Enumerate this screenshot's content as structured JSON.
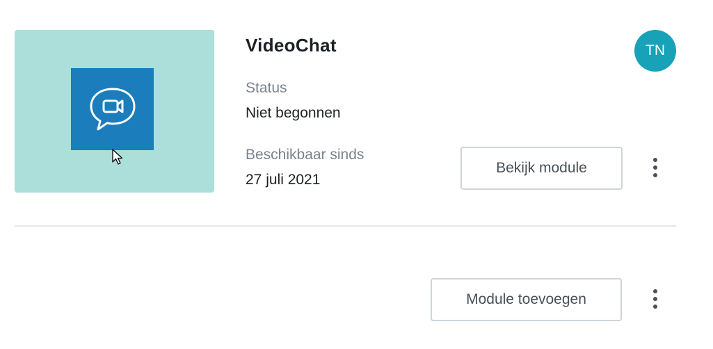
{
  "module": {
    "title": "VideoChat",
    "thumbnail_icon": "video-chat-bubble-icon",
    "status_label": "Status",
    "status_value": "Niet begonnen",
    "available_label": "Beschikbaar sinds",
    "available_value": "27 juli 2021",
    "view_button": "Bekijk module",
    "more_icon": "kebab-menu-icon"
  },
  "user": {
    "avatar_initials": "TN"
  },
  "footer": {
    "add_button": "Module toevoegen",
    "more_icon": "kebab-menu-icon"
  },
  "colors": {
    "thumbnail_bg": "#acdeda",
    "icon_bg": "#1b7dbb",
    "avatar_bg": "#17a2b8"
  }
}
